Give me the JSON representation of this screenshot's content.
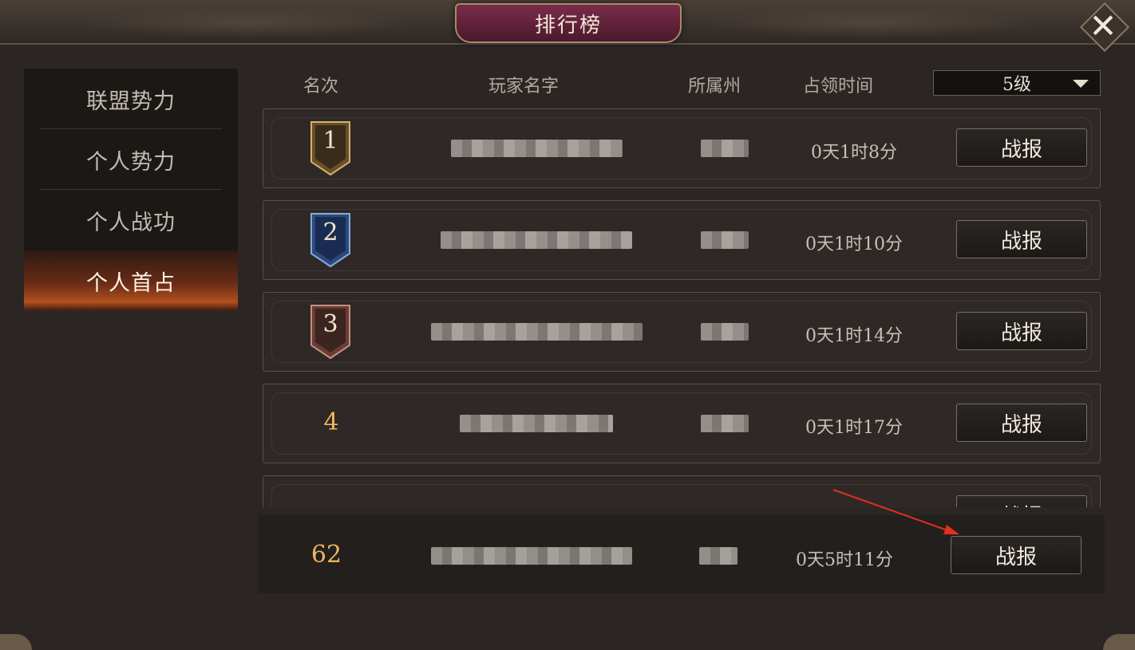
{
  "title": "排行榜",
  "close_icon": "close-icon",
  "sidebar": {
    "items": [
      {
        "label": "联盟势力",
        "active": false
      },
      {
        "label": "个人势力",
        "active": false
      },
      {
        "label": "个人战功",
        "active": false
      },
      {
        "label": "个人首占",
        "active": true
      }
    ]
  },
  "columns": {
    "rank": "名次",
    "player_name": "玩家名字",
    "state": "所属州",
    "occupy_time": "占领时间"
  },
  "level_select": {
    "value": "5级",
    "icon": "chevron-down-icon"
  },
  "rows": [
    {
      "rank": "1",
      "badge": "gold",
      "player_name": "",
      "state": "",
      "time": "0天1时8分",
      "button": "战报"
    },
    {
      "rank": "2",
      "badge": "blue",
      "player_name": "",
      "state": "",
      "time": "0天1时10分",
      "button": "战报"
    },
    {
      "rank": "3",
      "badge": "bronze",
      "player_name": "",
      "state": "",
      "time": "0天1时14分",
      "button": "战报"
    },
    {
      "rank": "4",
      "badge": "none",
      "player_name": "",
      "state": "",
      "time": "0天1时17分",
      "button": "战报"
    },
    {
      "rank": "",
      "badge": "none",
      "player_name": "",
      "state": "",
      "time": "",
      "button": "战报"
    }
  ],
  "my_row": {
    "rank": "62",
    "player_name": "",
    "state": "",
    "time": "0天5时11分",
    "button": "战报"
  },
  "colors": {
    "accent_orange": "#f0b560",
    "active_tab": "#b0501e",
    "title_plate": "#7a2c48",
    "arrow": "#e03020"
  }
}
